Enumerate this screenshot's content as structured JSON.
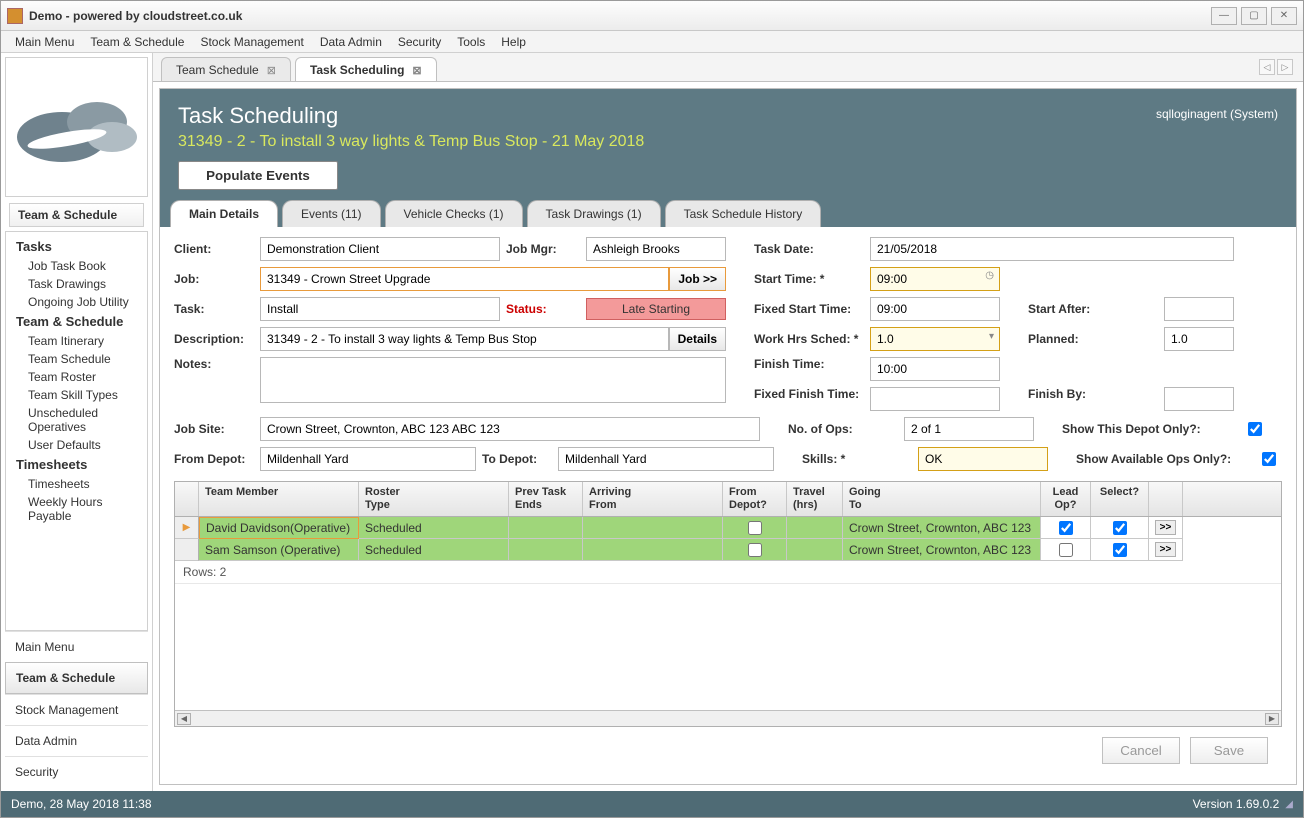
{
  "window": {
    "title": "Demo - powered by cloudstreet.co.uk"
  },
  "menubar": [
    "Main Menu",
    "Team & Schedule",
    "Stock Management",
    "Data Admin",
    "Security",
    "Tools",
    "Help"
  ],
  "sidebar": {
    "header": "Team & Schedule",
    "groups": [
      {
        "title": "Tasks",
        "items": [
          "Job Task Book",
          "Task Drawings",
          "Ongoing Job Utility"
        ]
      },
      {
        "title": "Team & Schedule",
        "items": [
          "Team Itinerary",
          "Team Schedule",
          "Team Roster",
          "Team Skill Types",
          "Unscheduled Operatives",
          "User Defaults"
        ]
      },
      {
        "title": "Timesheets",
        "items": [
          "Timesheets",
          "Weekly Hours Payable"
        ]
      }
    ],
    "bottom": [
      "Main Menu",
      "Team & Schedule",
      "Stock Management",
      "Data Admin",
      "Security"
    ]
  },
  "tabs": [
    {
      "label": "Team Schedule"
    },
    {
      "label": "Task Scheduling"
    }
  ],
  "page": {
    "title": "Task Scheduling",
    "subtitle": "31349 - 2 - To install 3 way lights & Temp Bus Stop - 21 May 2018",
    "user": "sqlloginagent (System)",
    "populate": "Populate Events"
  },
  "inner_tabs": [
    "Main Details",
    "Events (11)",
    "Vehicle Checks (1)",
    "Task Drawings (1)",
    "Task Schedule History"
  ],
  "form": {
    "client_lbl": "Client:",
    "client": "Demonstration Client",
    "jobmgr_lbl": "Job Mgr:",
    "jobmgr": "Ashleigh Brooks",
    "taskdate_lbl": "Task Date:",
    "taskdate": "21/05/2018",
    "job_lbl": "Job:",
    "job": "31349 - Crown Street Upgrade",
    "job_btn": "Job >>",
    "start_lbl": "Start Time: *",
    "start": "09:00",
    "task_lbl": "Task:",
    "task": "Install",
    "status_lbl": "Status:",
    "status": "Late Starting",
    "fixedstart_lbl": "Fixed Start Time:",
    "fixedstart": "09:00",
    "startafter_lbl": "Start After:",
    "startafter": "",
    "desc_lbl": "Description:",
    "desc": "31349 - 2 - To install 3 way lights & Temp Bus Stop",
    "details_btn": "Details",
    "workhrs_lbl": "Work Hrs Sched: *",
    "workhrs": "1.0",
    "planned_lbl": "Planned:",
    "planned": "1.0",
    "notes_lbl": "Notes:",
    "notes": "",
    "finish_lbl": "Finish Time:",
    "finish": "10:00",
    "fixedfinish_lbl": "Fixed Finish Time:",
    "fixedfinish": "",
    "finishby_lbl": "Finish By:",
    "finishby": "",
    "jobsite_lbl": "Job Site:",
    "jobsite": "Crown Street, Crownton, ABC 123 ABC 123",
    "noops_lbl": "No. of Ops:",
    "noops": "2 of 1",
    "showdepot_lbl": "Show This Depot Only?:",
    "fromdepot_lbl": "From Depot:",
    "fromdepot": "Mildenhall Yard",
    "todepot_lbl": "To Depot:",
    "todepot": "Mildenhall Yard",
    "skills_lbl": "Skills: *",
    "skills": "OK",
    "showavail_lbl": "Show Available Ops Only?:"
  },
  "table": {
    "headers": [
      "",
      "Team Member",
      "Roster\nType",
      "Prev Task\nEnds",
      "Arriving\nFrom",
      "From\nDepot?",
      "Travel\n(hrs)",
      "Going\nTo",
      "Lead\nOp?",
      "Select?",
      ""
    ],
    "rows": [
      {
        "name": "David Davidson(Operative)",
        "roster": "Scheduled",
        "going": "Crown Street, Crownton, ABC 123",
        "lead": true,
        "select": true,
        "active": true
      },
      {
        "name": "Sam Samson (Operative)",
        "roster": "Scheduled",
        "going": "Crown Street, Crownton, ABC 123",
        "lead": false,
        "select": true,
        "active": false
      }
    ],
    "count": "Rows: 2"
  },
  "actions": {
    "cancel": "Cancel",
    "save": "Save"
  },
  "statusbar": {
    "left": "Demo, 28 May 2018 11:38",
    "right": "Version 1.69.0.2"
  }
}
